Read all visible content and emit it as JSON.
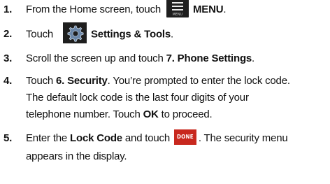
{
  "steps": [
    {
      "number": "1.",
      "text_before": "From the Home screen, touch",
      "icon_name": "menu-icon",
      "icon_label": "MENU",
      "bold_after": "MENU",
      "text_after": "."
    },
    {
      "number": "2.",
      "text_before": "Touch",
      "icon_name": "gear-icon",
      "bold_after": "Settings & Tools",
      "text_after": "."
    },
    {
      "number": "3.",
      "text_before": "Scroll the screen up and touch ",
      "bold": "7. Phone Settings",
      "text_after": "."
    },
    {
      "number": "4.",
      "text_before": "Touch ",
      "bold": "6. Security",
      "text_mid": ". You’re prompted to enter the lock code.",
      "line2": "The default lock code is the last four digits of your",
      "line3_before": "telephone number. Touch ",
      "line3_bold": "OK",
      "line3_after": " to proceed."
    },
    {
      "number": "5.",
      "text_before": "Enter the ",
      "bold": "Lock Code",
      "text_mid": " and touch",
      "icon_name": "done-icon",
      "icon_label": "DONE",
      "text_after": ". The security menu",
      "line2": "appears in the display."
    }
  ],
  "colors": {
    "text": "#111111",
    "icon_bg": "#1e1e1e",
    "done_bg": "#c8281e"
  }
}
